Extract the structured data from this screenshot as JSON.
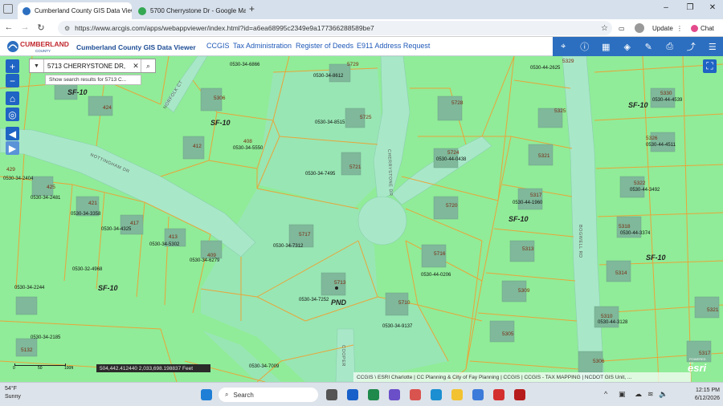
{
  "browser": {
    "tabs": [
      {
        "title": "Cumberland County GIS Data Viewer",
        "active": true
      },
      {
        "title": "5700 Cherrystone Dr - Google Ma",
        "active": false
      }
    ],
    "new_tab": "+",
    "url": "https://www.arcgis.com/apps/webappviewer/index.html?id=a6ea68995c2349e9a177366288589be7",
    "update_label": "Update",
    "chat_label": "Chat"
  },
  "app": {
    "logo_text": "CUMBERLAND",
    "logo_sub": "COUNTY",
    "title": "Cumberland County GIS Data Viewer",
    "links": [
      "CCGIS",
      "Tax Administration",
      "Register of Deeds",
      "E911 Address Request"
    ],
    "tools": [
      "measure-tool-icon",
      "info-icon",
      "basemap-icon",
      "layers-icon",
      "draw-icon",
      "print-icon",
      "share-icon",
      "menu-icon"
    ]
  },
  "map": {
    "search_value": "5713 CHERRYSTONE DR,",
    "search_suggestion": "Show search results for 5713 C...",
    "coordinates": "504,442.412440 2,033,698.198837 Feet",
    "attribution": "CCGIS \\ ESRI Charlotte | CC Planning & City of Fay Planning | CCGIS | CCGIS - TAX MAPPING | NCDOT GIS Unit, ...",
    "esri_label": "esri",
    "esri_powered": "POWERED BY",
    "scale_labels": [
      "0",
      "50",
      "100ft"
    ],
    "zones": [
      "SF-10",
      "SF-10",
      "SF-10",
      "SF-10",
      "SF-10",
      "SF-10",
      "PND"
    ],
    "streets": [
      "NOTTINGHAM DR",
      "CHERRYSTONE DR",
      "NORFOLK CT",
      "BOGWELL RD",
      "COOPER"
    ],
    "parcels": [
      {
        "pin": "0530-34-6866",
        "addr": "5729"
      },
      {
        "pin": "0530-34-8612",
        "addr": ""
      },
      {
        "pin": "0530-44-2625",
        "addr": "5329"
      },
      {
        "pin": "",
        "addr": "424"
      },
      {
        "pin": "",
        "addr": "5306"
      },
      {
        "pin": "0530-34-8515",
        "addr": "5725"
      },
      {
        "pin": "",
        "addr": "5728"
      },
      {
        "pin": "",
        "addr": "5325"
      },
      {
        "pin": "0530-44-4539",
        "addr": "5330"
      },
      {
        "pin": "0530-34-5550",
        "addr": "408"
      },
      {
        "pin": "",
        "addr": "412"
      },
      {
        "pin": "0530-34-7495",
        "addr": "5721"
      },
      {
        "pin": "0530-44-0438",
        "addr": "5724"
      },
      {
        "pin": "",
        "addr": "5321"
      },
      {
        "pin": "0530-44-4511",
        "addr": "5326"
      },
      {
        "pin": "0530-34-2404",
        "addr": "429"
      },
      {
        "pin": "0530-34-2481",
        "addr": "425"
      },
      {
        "pin": "0530-34-3358",
        "addr": "421"
      },
      {
        "pin": "0530-34-4325",
        "addr": "417"
      },
      {
        "pin": "",
        "addr": "5720"
      },
      {
        "pin": "0530-44-1960",
        "addr": "5317"
      },
      {
        "pin": "0530-44-3492",
        "addr": "5322"
      },
      {
        "pin": "0530-34-5302",
        "addr": "413"
      },
      {
        "pin": "0530-34-6279",
        "addr": "409"
      },
      {
        "pin": "0530-34-7312",
        "addr": "5717"
      },
      {
        "pin": "0530-44-0206",
        "addr": "5716"
      },
      {
        "pin": "",
        "addr": "5313"
      },
      {
        "pin": "0530-44-3374",
        "addr": "5318"
      },
      {
        "pin": "0530-32-4968",
        "addr": ""
      },
      {
        "pin": "0530-34-2244",
        "addr": ""
      },
      {
        "pin": "0530-34-7252",
        "addr": "5713"
      },
      {
        "pin": "",
        "addr": "5314"
      },
      {
        "pin": "",
        "addr": "5309"
      },
      {
        "pin": "0530-34-9137",
        "addr": "5710"
      },
      {
        "pin": "0530-44-3128",
        "addr": "5310"
      },
      {
        "pin": "",
        "addr": "5321"
      },
      {
        "pin": "0530-34-2185",
        "addr": ""
      },
      {
        "pin": "",
        "addr": "5305"
      },
      {
        "pin": "",
        "addr": "5132"
      },
      {
        "pin": "0530-34-7009",
        "addr": ""
      },
      {
        "pin": "",
        "addr": "5306"
      },
      {
        "pin": "",
        "addr": "5317"
      }
    ]
  },
  "taskbar": {
    "weather_temp": "54°F",
    "weather_desc": "Sunny",
    "search_label": "Search",
    "time": "12:15 PM",
    "date": "6/12/2026"
  },
  "colors": {
    "parcel_fill": "#90ec98",
    "parcel_line": "#e8a53a",
    "road_fill": "#a8e8c8",
    "building": "#7fb89a",
    "header_blue": "#1c4c94",
    "tool_blue": "#2c6fc0"
  }
}
